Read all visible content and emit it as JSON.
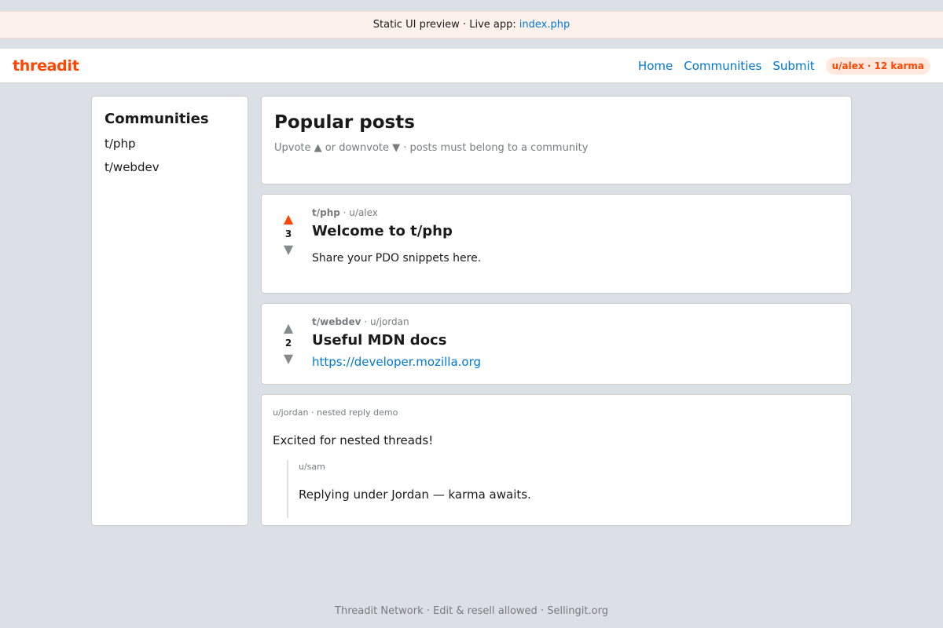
{
  "banner": {
    "text": "Static UI preview · Live app:",
    "link": "index.php"
  },
  "header": {
    "brand": "threadit",
    "nav": [
      "Home",
      "Communities",
      "Submit"
    ],
    "user_badge": "u/alex · 12 karma"
  },
  "sidebar": {
    "title": "Communities",
    "items": [
      "t/php",
      "t/webdev"
    ]
  },
  "main": {
    "title": "Popular posts",
    "subtitle": "Upvote ▲ or downvote ▼ · posts must belong to a community"
  },
  "posts": [
    {
      "community": "t/php",
      "author": "· u/alex",
      "title": "Welcome to t/php",
      "score": "3",
      "body": "Share your PDO snippets here.",
      "upvoted": true
    },
    {
      "community": "t/webdev",
      "author": "· u/jordan",
      "title": "Useful MDN docs",
      "score": "2",
      "link": "https://developer.mozilla.org",
      "upvoted": false
    }
  ],
  "comment": {
    "meta": "u/jordan · nested reply demo",
    "text": "Excited for nested threads!",
    "reply": {
      "meta": "u/sam",
      "text": "Replying under Jordan — karma awaits."
    }
  },
  "footer": {
    "text": "Threadit Network · Edit & resell allowed · Sellingit.org"
  },
  "icons": {
    "upvote": "▲",
    "downvote": "▼"
  },
  "colors": {
    "brand": "#ff4500",
    "link": "#0079d3",
    "background": "#dae0e6"
  }
}
